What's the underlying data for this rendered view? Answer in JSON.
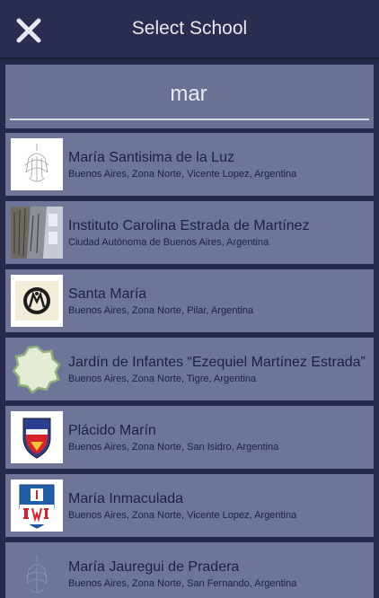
{
  "header": {
    "title": "Select School",
    "close_icon": "close-icon"
  },
  "search": {
    "value": "mar",
    "placeholder": ""
  },
  "colors": {
    "background": "#26294a",
    "header": "#2a2d4f",
    "item": "#6e7599",
    "search": "#6a7195"
  },
  "schools": [
    {
      "name": "María Santisima de la Luz",
      "location": "Buenos Aires, Zona Norte, Vicente Lopez, Argentina",
      "logo": "chandelier-logo"
    },
    {
      "name": "Instituto Carolina Estrada de Martínez",
      "location": "Ciudad Autónoma de Buenos Aires, Argentina",
      "logo": "building-photo"
    },
    {
      "name": "Santa María",
      "location": "Buenos Aires, Zona Norte, Pilar, Argentina",
      "logo": "crest-logo"
    },
    {
      "name": "Jardín de Infantes “Ezequiel Martínez Estrada”",
      "location": "Buenos Aires, Zona Norte, Tigre, Argentina",
      "logo": "green-badge-logo"
    },
    {
      "name": "Plácido Marín",
      "location": "Buenos Aires, Zona Norte, San Isidro, Argentina",
      "logo": "shield-logo"
    },
    {
      "name": "María Inmaculada",
      "location": "Buenos Aires, Zona Norte, Vicente Lopez, Argentina",
      "logo": "mi-shield-logo"
    },
    {
      "name": "María Jauregui de Pradera",
      "location": "Buenos Aires, Zona Norte, San Fernando, Argentina",
      "logo": "chandelier-logo"
    }
  ]
}
